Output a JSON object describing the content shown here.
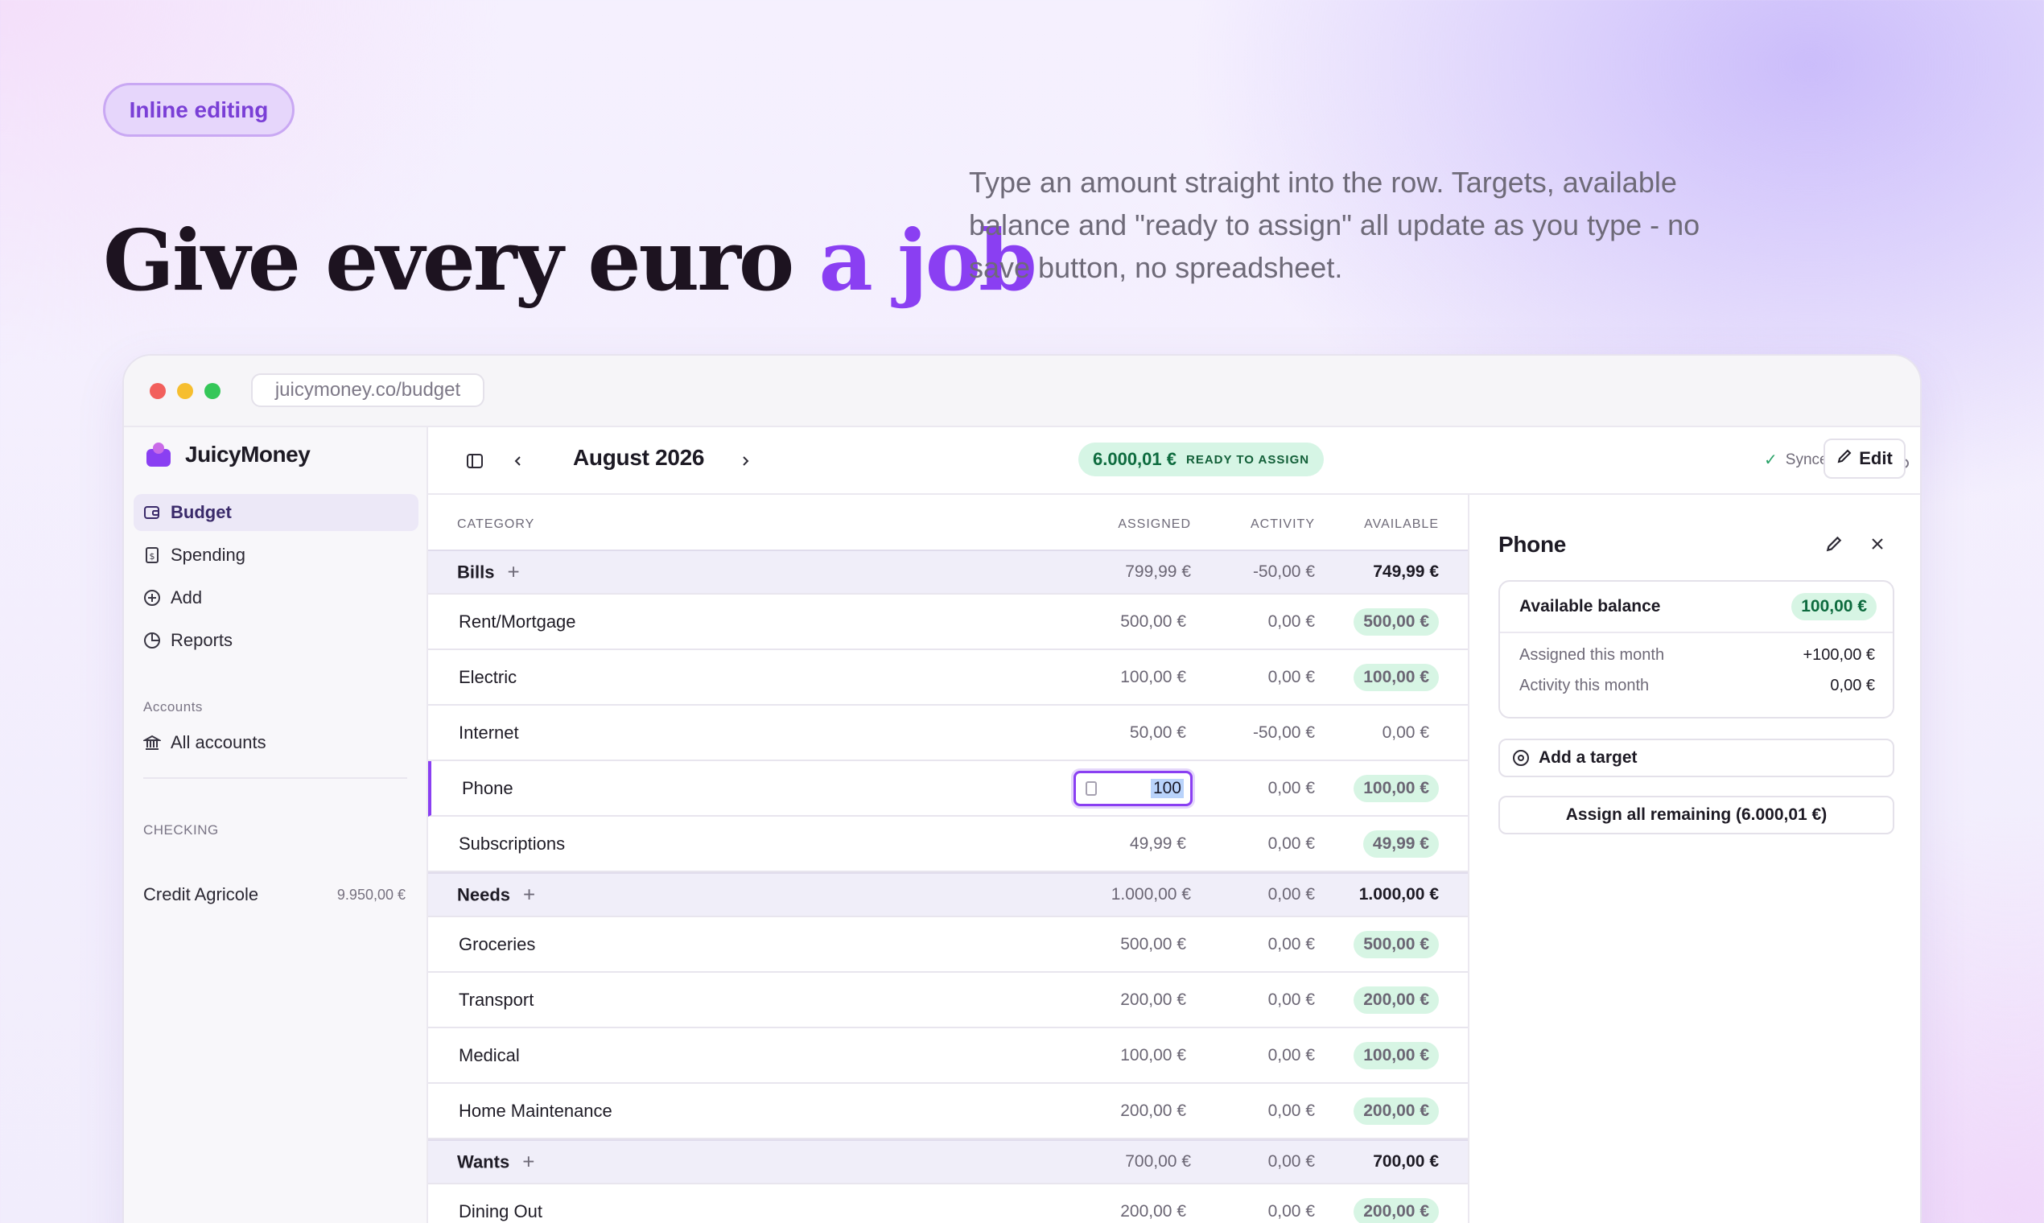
{
  "hero": {
    "pill": "Inline editing",
    "headline_main": "Give every euro ",
    "headline_accent": "a job",
    "lede": "Type an amount straight into the row. Targets, available balance and \"ready to assign\" all update as you type - no save button, no spreadsheet."
  },
  "browser": {
    "url": "juicymoney.co/budget"
  },
  "sidebar": {
    "brand": "JuicyMoney",
    "nav": [
      {
        "label": "Budget",
        "icon": "wallet-icon"
      },
      {
        "label": "Spending",
        "icon": "receipt-icon"
      },
      {
        "label": "Add",
        "icon": "plus-circle-icon"
      },
      {
        "label": "Reports",
        "icon": "pie-chart-icon"
      }
    ],
    "accounts_heading": "Accounts",
    "all_accounts": "All accounts",
    "checking_heading": "CHECKING",
    "account": {
      "name": "Credit Agricole",
      "balance": "9.950,00 €"
    }
  },
  "topbar": {
    "month": "August 2026",
    "ready_amount": "6.000,01 €",
    "ready_label": "READY TO ASSIGN",
    "synced": "Synced",
    "edit": "Edit"
  },
  "table": {
    "headers": {
      "category": "CATEGORY",
      "assigned": "ASSIGNED",
      "activity": "ACTIVITY",
      "available": "AVAILABLE"
    },
    "rows": [
      {
        "type": "group",
        "name": "Bills",
        "assigned": "799,99 €",
        "activity": "-50,00 €",
        "available": "749,99 €"
      },
      {
        "type": "item",
        "name": "Rent/Mortgage",
        "assigned": "500,00 €",
        "activity": "0,00 €",
        "available": "500,00 €",
        "badge": true
      },
      {
        "type": "item",
        "name": "Electric",
        "assigned": "100,00 €",
        "activity": "0,00 €",
        "available": "100,00 €",
        "badge": true
      },
      {
        "type": "item",
        "name": "Internet",
        "assigned": "50,00 €",
        "activity": "-50,00 €",
        "available": "0,00 €",
        "badge": false
      },
      {
        "type": "item",
        "name": "Phone",
        "assigned": "100",
        "activity": "0,00 €",
        "available": "100,00 €",
        "badge": true,
        "editing": true
      },
      {
        "type": "item",
        "name": "Subscriptions",
        "assigned": "49,99 €",
        "activity": "0,00 €",
        "available": "49,99 €",
        "badge": true
      },
      {
        "type": "group",
        "name": "Needs",
        "assigned": "1.000,00 €",
        "activity": "0,00 €",
        "available": "1.000,00 €"
      },
      {
        "type": "item",
        "name": "Groceries",
        "assigned": "500,00 €",
        "activity": "0,00 €",
        "available": "500,00 €",
        "badge": true
      },
      {
        "type": "item",
        "name": "Transport",
        "assigned": "200,00 €",
        "activity": "0,00 €",
        "available": "200,00 €",
        "badge": true
      },
      {
        "type": "item",
        "name": "Medical",
        "assigned": "100,00 €",
        "activity": "0,00 €",
        "available": "100,00 €",
        "badge": true
      },
      {
        "type": "item",
        "name": "Home Maintenance",
        "assigned": "200,00 €",
        "activity": "0,00 €",
        "available": "200,00 €",
        "badge": true
      },
      {
        "type": "group",
        "name": "Wants",
        "assigned": "700,00 €",
        "activity": "0,00 €",
        "available": "700,00 €"
      },
      {
        "type": "item",
        "name": "Dining Out",
        "assigned": "200,00 €",
        "activity": "0,00 €",
        "available": "200,00 €",
        "badge": true
      }
    ]
  },
  "panel": {
    "title": "Phone",
    "available_label": "Available balance",
    "available_value": "100,00 €",
    "assigned_label": "Assigned this month",
    "assigned_value": "+100,00 €",
    "activity_label": "Activity this month",
    "activity_value": "0,00 €",
    "add_target": "Add a target",
    "assign_all": "Assign all remaining (6.000,01 €)"
  },
  "colors": {
    "accent": "#8a3ff2",
    "positive_bg": "#d7f5e4",
    "positive_text": "#0d6b3e"
  }
}
